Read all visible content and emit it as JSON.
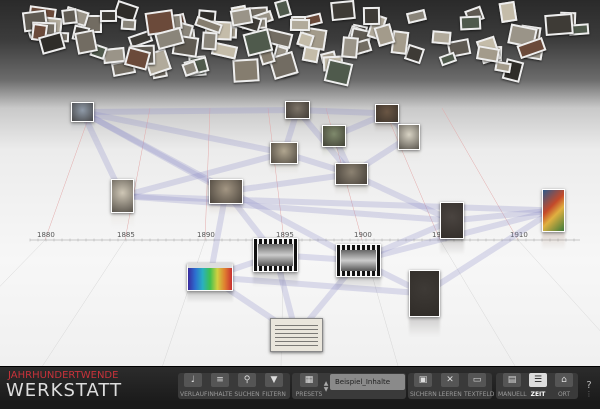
{
  "app": {
    "logo_top": "JAHRHUNDERTWENDE",
    "logo_bottom": "WERKSTATT"
  },
  "timeline": {
    "years": [
      "1880",
      "1885",
      "1890",
      "1895",
      "1900",
      "1905",
      "1910"
    ]
  },
  "toolbar": {
    "verlauf": "VERLAUF",
    "inhalte": "INHALTE",
    "suchen": "SUCHEN",
    "filtern": "FILTERN",
    "presets": "PRESETS",
    "preset_value": "Beispiel_Inhalte",
    "sichern": "SICHERN",
    "leeren": "LEEREN",
    "textfeld": "TEXTFELD",
    "manuell": "MANUELL",
    "zeit": "ZEIT",
    "ort": "ORT",
    "help": "?"
  },
  "colors": {
    "accent": "#c8323a",
    "link": "#8f8fc8"
  }
}
